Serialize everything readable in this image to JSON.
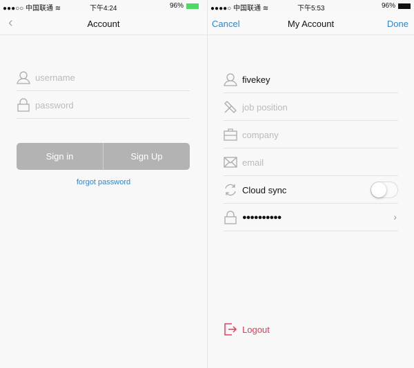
{
  "left": {
    "status": {
      "signal": "●●●○○",
      "carrier": "中国联通",
      "time": "下午4:24",
      "battery": "96%"
    },
    "nav": {
      "title": "Account"
    },
    "fields": [
      {
        "placeholder": "username",
        "icon": "user-icon"
      },
      {
        "placeholder": "password",
        "icon": "lock-icon"
      }
    ],
    "sign_in": "Sign in",
    "sign_up": "Sign Up",
    "forgot": "forgot password"
  },
  "right": {
    "status": {
      "signal": "●●●●○",
      "carrier": "中国联通",
      "time": "下午5:53",
      "battery": "96%"
    },
    "nav": {
      "title": "My Account",
      "cancel": "Cancel",
      "done": "Done"
    },
    "fields": [
      {
        "value": "fivekey",
        "icon": "user-icon"
      },
      {
        "placeholder": "job position",
        "icon": "tools-icon"
      },
      {
        "placeholder": "company",
        "icon": "briefcase-icon"
      },
      {
        "placeholder": "email",
        "icon": "mail-icon"
      },
      {
        "label": "Cloud sync",
        "icon": "sync-icon",
        "toggle": false
      },
      {
        "value": "●●●●●●●●●●",
        "icon": "lock-icon"
      }
    ],
    "logout": "Logout"
  },
  "colors": {
    "accent": "#2f86c8",
    "danger": "#e0405a",
    "button": "#b3b3b3"
  }
}
